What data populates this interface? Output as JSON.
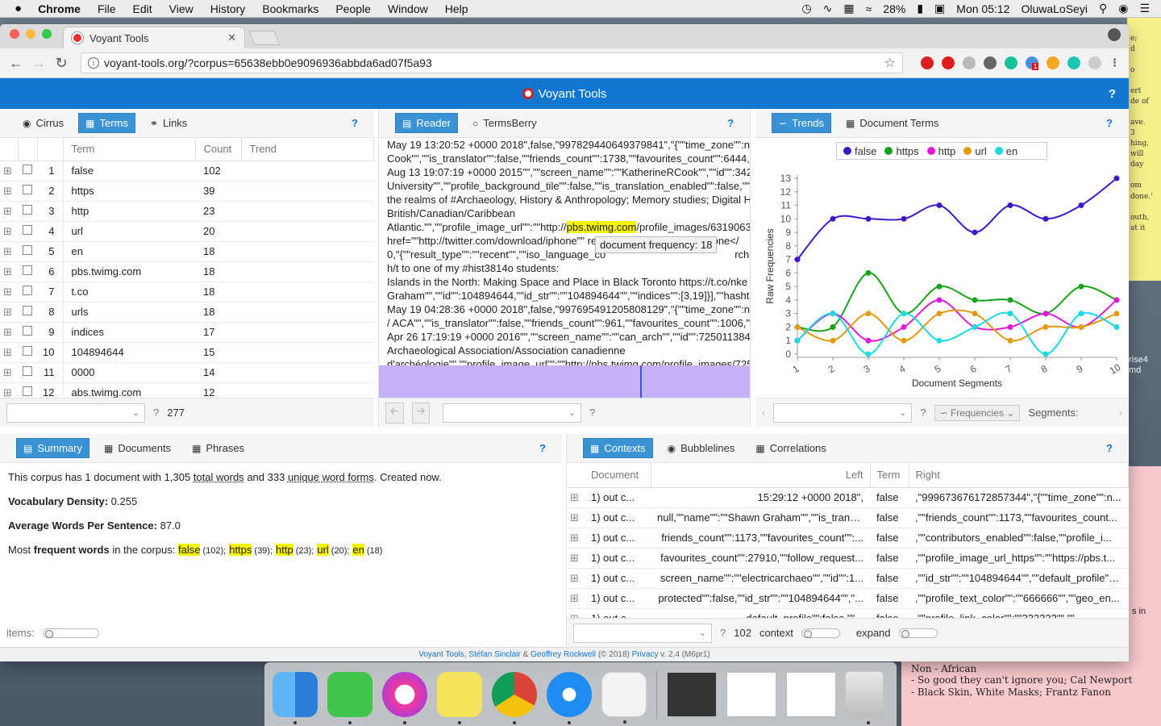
{
  "desktop": {
    "sticky_yellow": [
      "e;",
      "d",
      "",
      "o",
      "",
      "ert",
      "de of",
      "",
      "ave.",
      "3",
      "hing,",
      "will",
      "day",
      "",
      "om",
      "done.'",
      "",
      "outh,",
      "at it"
    ],
    "sticky_pink": [
      "Non - African",
      "- So good they can't ignore you; Cal Newport",
      "- Black Skin, White Masks; Frantz Fanon"
    ],
    "right_text": [
      "rise4",
      "md"
    ],
    "side_text": "s in"
  },
  "menubar": {
    "apple": "",
    "app": "Chrome",
    "items": [
      "File",
      "Edit",
      "View",
      "History",
      "Bookmarks",
      "People",
      "Window",
      "Help"
    ],
    "battery": "28%",
    "clock": "Mon 05:12",
    "user": "OluwaLoSeyi"
  },
  "browser": {
    "tab_title": "Voyant Tools",
    "url": "voyant-tools.org/?corpus=65638ebb0e9096936abbda6ad07f5a93",
    "ext_badge": "1"
  },
  "app": {
    "title": "Voyant Tools",
    "help": "?"
  },
  "terms_panel": {
    "tabs": [
      "Cirrus",
      "Terms",
      "Links"
    ],
    "active": "Terms",
    "columns": [
      "Term",
      "Count",
      "Trend"
    ],
    "rows": [
      {
        "n": "1",
        "term": "false",
        "count": "102"
      },
      {
        "n": "2",
        "term": "https",
        "count": "39"
      },
      {
        "n": "3",
        "term": "http",
        "count": "23"
      },
      {
        "n": "4",
        "term": "url",
        "count": "20"
      },
      {
        "n": "5",
        "term": "en",
        "count": "18"
      },
      {
        "n": "6",
        "term": "pbs.twimg.com",
        "count": "18"
      },
      {
        "n": "7",
        "term": "t.co",
        "count": "18"
      },
      {
        "n": "8",
        "term": "urls",
        "count": "18"
      },
      {
        "n": "9",
        "term": "indices",
        "count": "17"
      },
      {
        "n": "10",
        "term": "104894644",
        "count": "15"
      },
      {
        "n": "11",
        "term": "0000",
        "count": "14"
      },
      {
        "n": "12",
        "term": "abs.twimg.com",
        "count": "12"
      }
    ],
    "total": "277"
  },
  "reader_panel": {
    "tabs": [
      "Reader",
      "TermsBerry"
    ],
    "active": "Reader",
    "lines": [
      "May 19 13:20:52 +0000 2018\",false,\"997829440649379841\",\"{\"\"time_zone\"\":nul",
      "Cook\"\",\"\"is_translator\"\":false,\"\"friends_count\"\":1738,\"\"favourites_count\"\":6444,\"\"fo",
      "Aug 13 19:07:19 +0000 2015\"\",\"\"screen_name\"\":\"\"KatherineRCook\"\",\"\"id\"\":34207",
      "University\"\",\"\"profile_background_tile\"\":false,\"\"is_translation_enabled\"\":false,\"\"pr",
      "the realms of #Archaeology, History & Anthropology; Memory studies; Digital H",
      "British/Canadian/Caribbean",
      "Atlantic.\"\",\"\"profile_image_url\"\":\"\"http://",
      "href=\"\"http://twitter.com/download/iphone\"\" re",
      "0,\"{\"\"result_type\"\":\"\"recent\"\",\"\"iso_language_co",
      "h/t to one of my #hist3814o students:",
      "Islands in the North: Making Space and Place in Black Toronto https://t.co/nke",
      "Graham\"\",\"\"id\"\":104894644,\"\"id_str\"\":\"\"104894644\"\",\"\"indices\"\":[3,19]}],\"\"hashtags",
      "May 19 04:28:36 +0000 2018\",false,\"997695491205808129\",\"{\"\"time_zone\"\":nul",
      "/ ACA\"\",\"\"is_translator\"\":false,\"\"friends_count\"\":961,\"\"favourites_count\"\":1006,\"\"fol",
      "Apr 26 17:19:19 +0000 2016\"\",\"\"screen_name\"\":\"\"can_arch\"\",\"\"id\"\":7250113849",
      "Archaeological Association/Association canadienne",
      "d'archéologie\"\",\"\"profile_image_url\"\":\"\"http://pbs.twimg.com/profile_images/725"
    ],
    "highlight": "pbs.twimg.com",
    "after_highlight": "/profile_images/631906350",
    "tail_7": "\"iPhone</",
    "tail_8": "rchaeo",
    "tooltip": "document frequency: 18"
  },
  "trends_panel": {
    "tabs": [
      "Trends",
      "Document Terms"
    ],
    "active": "Trends",
    "footer_button": "Frequencies",
    "footer_label": "Segments:"
  },
  "chart_data": {
    "type": "line",
    "xlabel": "Document Segments",
    "ylabel": "Raw Frequencies",
    "categories": [
      "1",
      "2",
      "3",
      "4",
      "5",
      "6",
      "7",
      "8",
      "9",
      "10"
    ],
    "ylim": [
      0,
      13
    ],
    "yticks": [
      "0",
      "1",
      "2",
      "3",
      "4",
      "5",
      "6",
      "7",
      "8",
      "9",
      "10",
      "11",
      "12",
      "13"
    ],
    "legend_position": "top",
    "series": [
      {
        "name": "false",
        "color": "#3f17c9",
        "values": [
          7,
          10,
          10,
          10,
          11,
          9,
          11,
          10,
          11,
          13
        ]
      },
      {
        "name": "https",
        "color": "#1ba21b",
        "values": [
          2,
          2,
          6,
          3,
          5,
          4,
          4,
          3,
          5,
          4
        ]
      },
      {
        "name": "http",
        "color": "#e21ad6",
        "values": [
          1,
          3,
          1,
          2,
          4,
          2,
          2,
          3,
          2,
          4
        ]
      },
      {
        "name": "url",
        "color": "#e39a10",
        "values": [
          2,
          1,
          3,
          1,
          3,
          3,
          1,
          2,
          2,
          3
        ]
      },
      {
        "name": "en",
        "color": "#1bd9e0",
        "values": [
          1,
          3,
          0,
          3,
          1,
          2,
          3,
          0,
          3,
          2
        ]
      }
    ]
  },
  "summary_panel": {
    "tabs": [
      "Summary",
      "Documents",
      "Phrases"
    ],
    "active": "Summary",
    "intro_a": "This corpus has 1 document with 1,305",
    "total_words": "total words",
    "and": "and 333",
    "unique": "unique word forms",
    "created": ". Created now.",
    "density_label": "Vocabulary Density:",
    "density_value": "0.255",
    "avg_label": "Average Words Per Sentence:",
    "avg_value": "87.0",
    "most_a": "Most",
    "most_b": "frequent words",
    "most_c": "in the corpus:",
    "freq_words": [
      {
        "w": "false",
        "c": "(102);"
      },
      {
        "w": "https",
        "c": "(39);"
      },
      {
        "w": "http",
        "c": "(23);"
      },
      {
        "w": "url",
        "c": "(20);"
      },
      {
        "w": "en",
        "c": "(18)"
      }
    ],
    "items_label": "items:"
  },
  "contexts_panel": {
    "tabs": [
      "Contexts",
      "Bubblelines",
      "Correlations"
    ],
    "active": "Contexts",
    "columns": [
      "Document",
      "Left",
      "Term",
      "Right"
    ],
    "rows": [
      {
        "doc": "1) out c...",
        "left": "15:29:12 +0000 2018\",",
        "term": "false",
        "right": ",\"999673676172857344\",\"{\"\"time_zone\"\":n..."
      },
      {
        "doc": "1) out c...",
        "left": "null,\"\"name\"\":\"\"Shawn Graham\"\",\"\"is_transl...",
        "term": "false",
        "right": ",\"\"friends_count\"\":1173,\"\"favourites_count..."
      },
      {
        "doc": "1) out c...",
        "left": "friends_count\"\":1173,\"\"favourites_count\"\":...",
        "term": "false",
        "right": ",\"\"contributors_enabled\"\":false,\"\"profile_i..."
      },
      {
        "doc": "1) out c...",
        "left": "favourites_count\"\":27910,\"\"follow_request...",
        "term": "false",
        "right": ",\"\"profile_image_url_https\"\":\"\"https://pbs.t..."
      },
      {
        "doc": "1) out c...",
        "left": "screen_name\"\":\"\"electricarchaeo\"\",\"\"id\"\":1...",
        "term": "false",
        "right": ",\"\"id_str\"\":\"\"104894644\"\",\"\"default_profile\"\":..."
      },
      {
        "doc": "1) out c...",
        "left": "protected\"\":false,\"\"id_str\"\":\"\"104894644\"\",\"...",
        "term": "false",
        "right": ",\"\"profile_text_color\"\":\"\"666666\"\",\"\"geo_en..."
      },
      {
        "doc": "1) out c...",
        "left": "default_profile\"\":false,\"\"...",
        "term": "false",
        "right": ",\"\"profile_link_color\"\":\"\"333333\"\",\"\"..."
      }
    ],
    "count": "102",
    "context_label": "context",
    "expand_label": "expand"
  },
  "footer": {
    "voyant": "Voyant Tools",
    "sep": ",",
    "author1": "Stéfan Sinclair",
    "amp": "&",
    "author2": "Geoffrey Rockwell",
    "year": "(© 2018)",
    "privacy": "Privacy",
    "version": "v. 2.4 (M6pr1)"
  }
}
